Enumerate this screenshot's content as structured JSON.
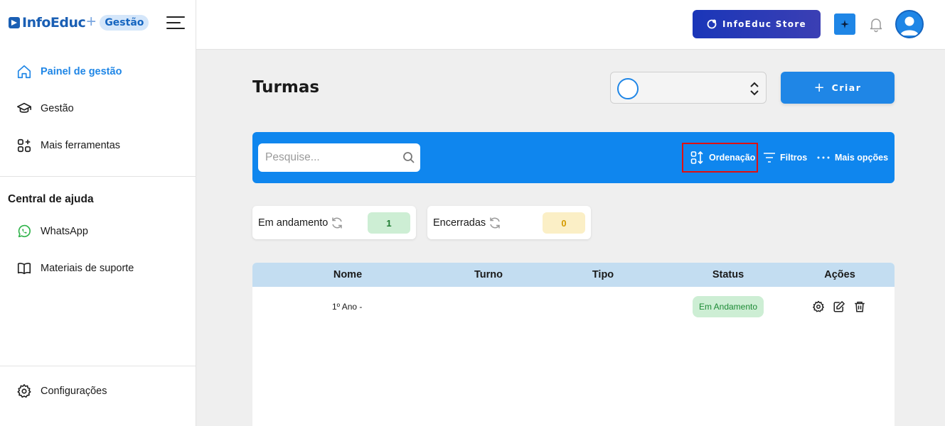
{
  "brand": {
    "name": "InfoEduc",
    "badge": "Gestão"
  },
  "sidebar": {
    "items": [
      {
        "label": "Painel de gestão",
        "icon": "home-icon",
        "active": true
      },
      {
        "label": "Gestão",
        "icon": "graduation-cap-icon"
      },
      {
        "label": "Mais ferramentas",
        "icon": "apps-grid-icon"
      }
    ],
    "help_title": "Central de ajuda",
    "help_items": [
      {
        "label": "WhatsApp",
        "icon": "whatsapp-icon"
      },
      {
        "label": "Materiais de suporte",
        "icon": "book-icon"
      }
    ],
    "settings_label": "Configurações"
  },
  "header": {
    "store_label": "InfoEduc Store"
  },
  "main": {
    "title": "Turmas",
    "create_label": "Criar",
    "search_placeholder": "Pesquise...",
    "sort_label": "Ordenação",
    "filter_label": "Filtros",
    "more_label": "Mais opções",
    "status_cards": [
      {
        "label": "Em andamento",
        "count": "1"
      },
      {
        "label": "Encerradas",
        "count": "0"
      }
    ],
    "table": {
      "columns": [
        "Nome",
        "Turno",
        "Tipo",
        "Status",
        "Ações"
      ],
      "rows": [
        {
          "nome": "1º Ano -",
          "turno": "",
          "tipo": "",
          "status": "Em Andamento"
        }
      ]
    }
  },
  "colors": {
    "primary": "#1f86e6",
    "store": "#1a36b8",
    "highlight": "#e01010",
    "success": "#cdeed4",
    "warning": "#fbefc6"
  }
}
